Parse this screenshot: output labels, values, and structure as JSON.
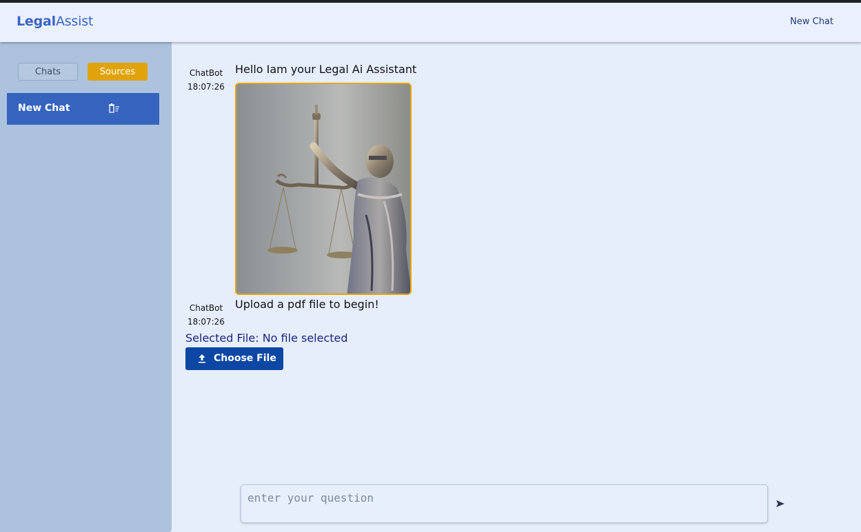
{
  "header": {
    "brand_part1": "Legal",
    "brand_part2": "Assist",
    "new_chat": "New Chat"
  },
  "sidebar": {
    "tabs": [
      {
        "label": "Chats"
      },
      {
        "label": "Sources"
      }
    ],
    "chats": [
      {
        "label": "New Chat",
        "icon": "delete-icon"
      }
    ]
  },
  "messages": [
    {
      "sender": "ChatBot",
      "time": "18:07:26",
      "text": "Hello Iam your Legal Ai Assistant",
      "image": "lady-justice-statue"
    },
    {
      "sender": "ChatBot",
      "time": "18:07:26",
      "text": "Upload a pdf file to begin!"
    }
  ],
  "upload": {
    "selected_text": "Selected File: No file selected",
    "button_label": "Choose File",
    "icon": "upload-icon"
  },
  "composer": {
    "placeholder": "enter your question",
    "send_icon": "send-icon"
  },
  "colors": {
    "accent": "#3563be",
    "sources_tab": "#e0a30b",
    "upload_button": "#0b47a3",
    "background": "#e6eefc",
    "sidebar": "#adc3dd"
  }
}
